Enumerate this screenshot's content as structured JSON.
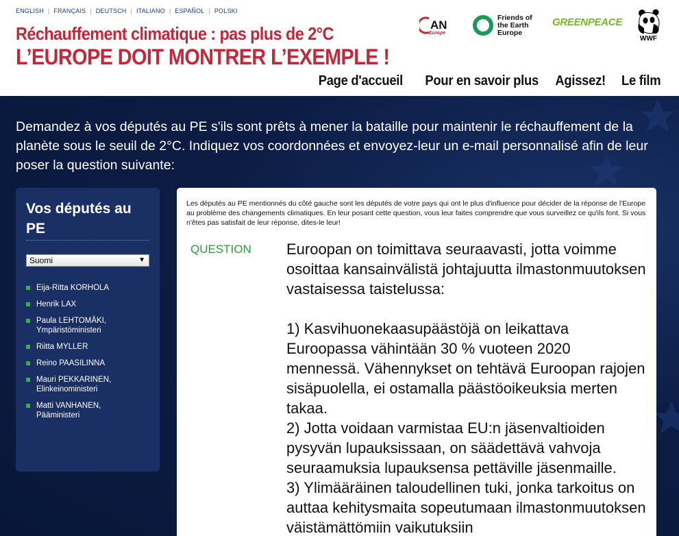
{
  "languages": [
    "ENGLISH",
    "FRANÇAIS",
    "DEUTSCH",
    "ITALIANO",
    "ESPAÑOL",
    "POLSKI"
  ],
  "header": {
    "title_line1": "Réchauffement climatique : pas plus de 2°C",
    "title_line2": "L’EUROPE DOIT MONTRER L’EXEMPLE !",
    "logos": {
      "can_text": "AN",
      "can_sub": "Europe",
      "foe_line1": "Friends of",
      "foe_line2": "the Earth",
      "foe_line3": "Europe",
      "greenpeace": "GREENPEACE",
      "wwf": "WWF"
    }
  },
  "nav": {
    "items": [
      "Page d'accueil",
      "Pour en savoir plus",
      "Agissez!",
      "Le film"
    ],
    "active_index": 2
  },
  "intro_text": "Demandez à vos députés au PE s'ils sont prêts à mener la bataille pour maintenir le réchauffement de la planète sous le seuil de 2°C. Indiquez vos coordonnées et envoyez-leur un e-mail personnalisé afin de leur poser la question suivante:",
  "sidebar": {
    "title": "Vos députés au PE",
    "selected_country": "Suomi",
    "meps": [
      {
        "name": "Eija-Ritta KORHOLA",
        "role": ""
      },
      {
        "name": "Henrik LAX",
        "role": ""
      },
      {
        "name": "Paula LEHTOMÄKI,",
        "role": "Ympäristöministeri"
      },
      {
        "name": "Riitta MYLLER",
        "role": ""
      },
      {
        "name": "Reino PAASILINNA",
        "role": ""
      },
      {
        "name": "Mauri PEKKARINEN,",
        "role": "Elinkeinoministeri"
      },
      {
        "name": "Matti VANHANEN,",
        "role": "Pääministeri"
      }
    ]
  },
  "content": {
    "intro": "Les députés au PE mentionnés du côté gauche sont les députés de votre pays qui ont le plus d'influence pour décider de la réponse de l'Europe au problème des changements climatiques. En leur posant cette question, vous leur faites comprendre que vous surveillez ce qu'ils font. Si vous n'êtes pas satisfait de leur réponse, dites-le leur!",
    "question_label": "QUESTION",
    "question_text": "Euroopan on toimittava seuraavasti, jotta voimme osoittaa kansainvälistä johtajuutta ilmastonmuutoksen vastaisessa taistelussa:\n\n1) Kasvihuonekaasupäästöjä on leikattava Euroopassa vähintään 30 % vuoteen 2020 mennessä. Vähennykset on tehtävä Euroopan rajojen sisäpuolella, ei ostamalla päästöoikeuksia merten takaa.\n2) Jotta voidaan varmistaa EU:n jäsenvaltioiden pysyvän lupauksissaan, on säädettävä vahvoja seuraamuksia lupauksensa pettäville jäsenmaille.\n3) Ylimääräinen taloudellinen tuki, jonka tarkoitus on auttaa kehitysmaita sopeutumaan ilmastonmuutoksen väistämättömiin vaikutuksiin"
  },
  "colors": {
    "title_red": "#c3283a",
    "bullet_green": "#38b04a",
    "question_green": "#2e9a3e",
    "sidebar_bg": "#1a2f63",
    "page_bg": "#0a1a3d"
  }
}
